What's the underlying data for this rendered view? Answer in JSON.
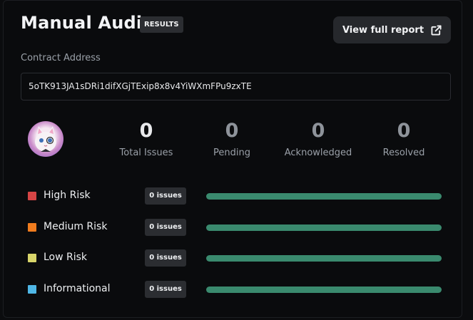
{
  "header": {
    "title": "Manual Audit",
    "badge": "RESULTS",
    "report_button": "View full report",
    "report_icon": "external-link-icon"
  },
  "contract": {
    "label": "Contract Address",
    "address": "5oTK913JA1sDRi1difXGjTExip8x8v4YiWXmFPu9zxTE"
  },
  "stats": [
    {
      "value": "0",
      "label": "Total Issues"
    },
    {
      "value": "0",
      "label": "Pending"
    },
    {
      "value": "0",
      "label": "Acknowledged"
    },
    {
      "value": "0",
      "label": "Resolved"
    }
  ],
  "risks": [
    {
      "name": "High Risk",
      "count": "0 issues",
      "color": "#d64545"
    },
    {
      "name": "Medium Risk",
      "count": "0 issues",
      "color": "#f07c1e"
    },
    {
      "name": "Low Risk",
      "count": "0 issues",
      "color": "#d8d56a"
    },
    {
      "name": "Informational",
      "count": "0 issues",
      "color": "#4fb7e6"
    }
  ],
  "colors": {
    "bar": "#3a8a6e",
    "background": "#0a0b0d"
  }
}
